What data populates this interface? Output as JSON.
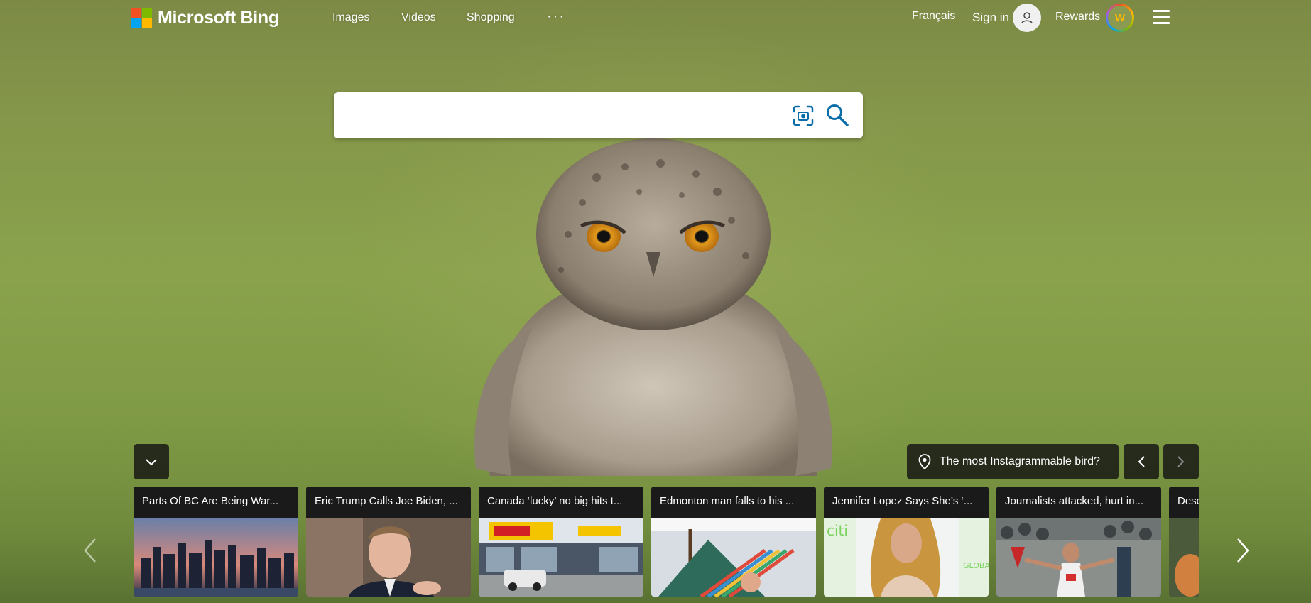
{
  "header": {
    "brand": "Microsoft Bing",
    "nav": [
      "Images",
      "Videos",
      "Shopping"
    ],
    "more": "···",
    "language": "Français",
    "sign_in": "Sign in",
    "rewards": "Rewards",
    "rewards_badge": "W"
  },
  "search": {
    "value": "",
    "placeholder": ""
  },
  "image_info": {
    "caption": "The most Instagrammable bird?"
  },
  "news": [
    {
      "title": "Parts Of BC Are Being War..."
    },
    {
      "title": "Eric Trump Calls Joe Biden, ..."
    },
    {
      "title": "Canada ‘lucky’ no big hits t..."
    },
    {
      "title": "Edmonton man falls to his ..."
    },
    {
      "title": "Jennifer Lopez Says She’s ‘..."
    },
    {
      "title": "Journalists attacked, hurt in..."
    },
    {
      "title": "Desc"
    }
  ],
  "icons": {
    "visual_search": "camera-scan-icon",
    "search": "search-icon",
    "avatar": "person-icon",
    "location": "location-pin-icon",
    "collapse": "chevron-down-icon",
    "prev": "chevron-left-icon",
    "next": "chevron-right-icon",
    "menu": "hamburger-menu-icon"
  },
  "colors": {
    "accent": "#0c6ea8",
    "logo": [
      "#f25022",
      "#7fba00",
      "#00a4ef",
      "#ffb900"
    ]
  }
}
